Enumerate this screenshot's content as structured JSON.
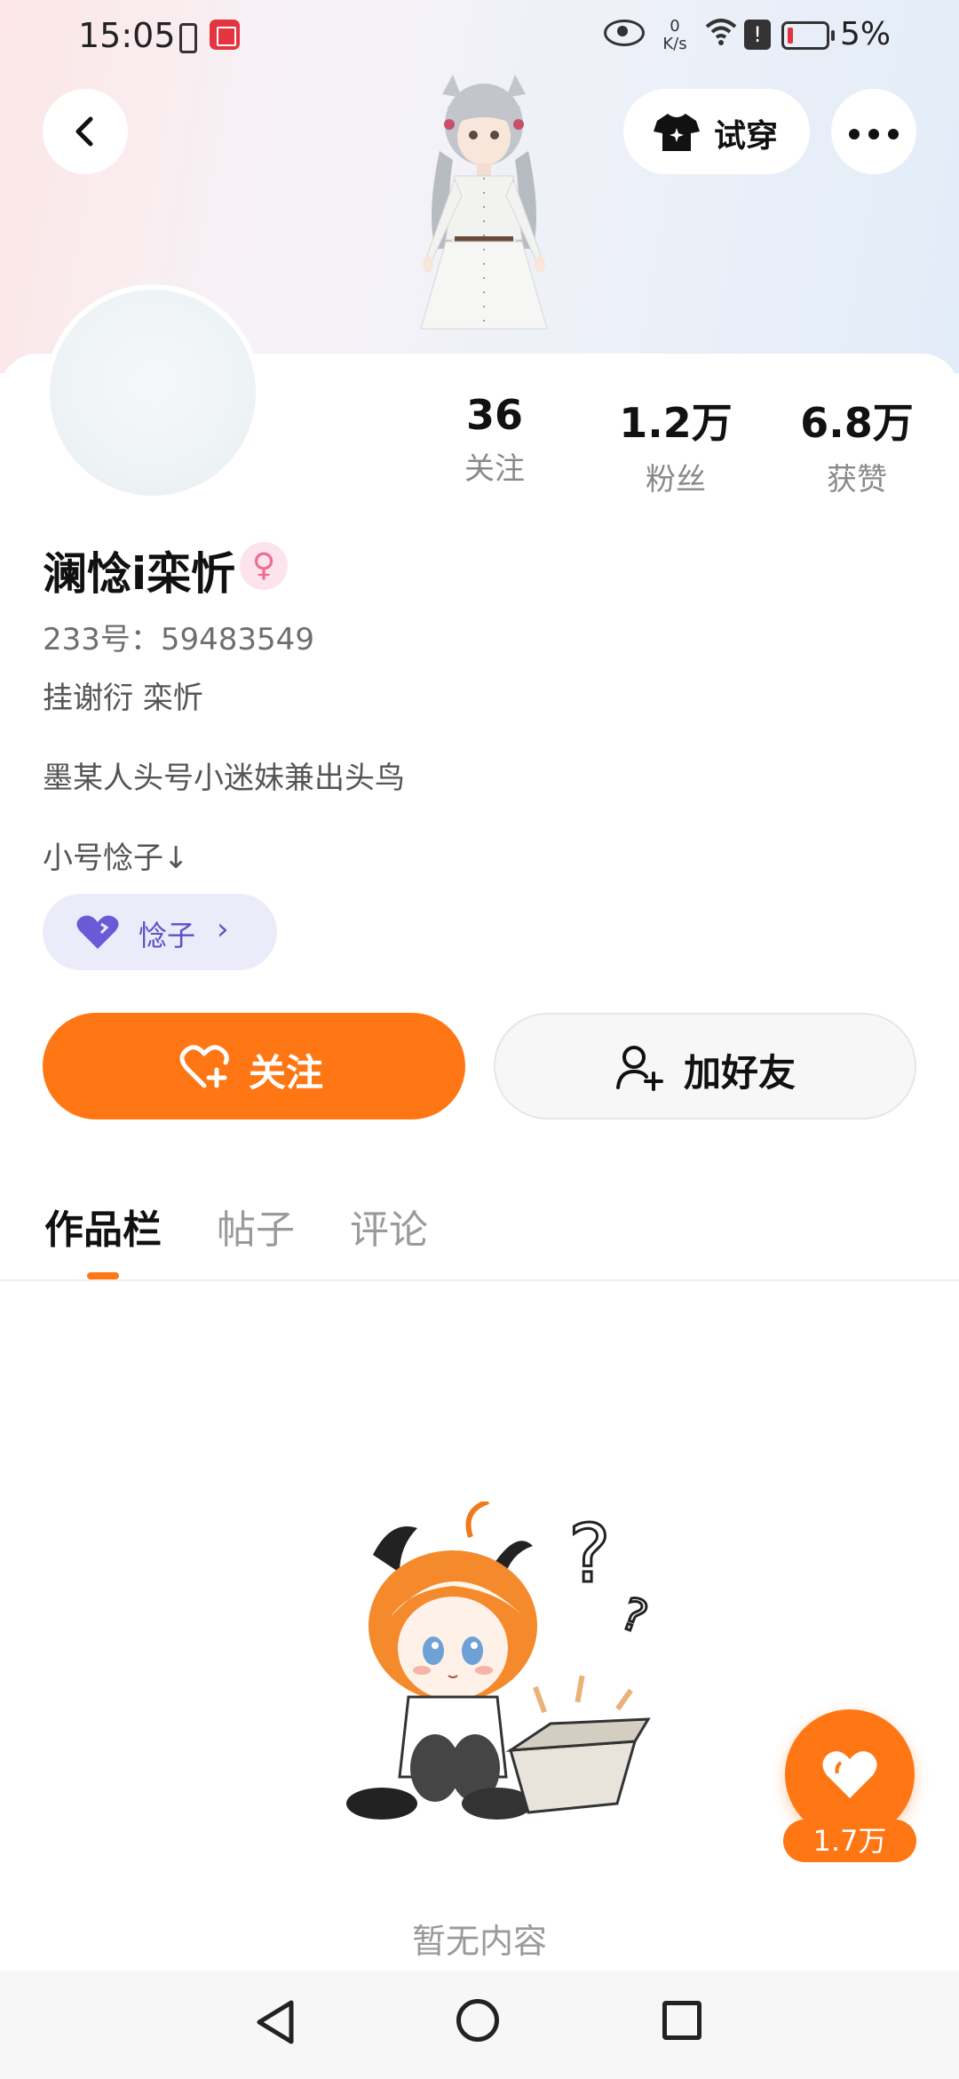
{
  "status_bar": {
    "time": "15:05",
    "net_speed_value": "0",
    "net_speed_unit": "K/s",
    "battery_percent": "5%",
    "icons": [
      "phone-icon",
      "reader-app-icon",
      "eye-icon",
      "wifi-icon",
      "alert-icon",
      "battery-icon"
    ]
  },
  "header": {
    "try_on_label": "试穿",
    "icons": [
      "back-arrow-icon",
      "tshirt-icon",
      "more-dots-icon"
    ]
  },
  "stats": [
    {
      "value": "36",
      "label": "关注"
    },
    {
      "value": "1.2万",
      "label": "粉丝"
    },
    {
      "value": "6.8万",
      "label": "获赞"
    }
  ],
  "profile": {
    "username": "澜惗i栾忻",
    "gender_symbol": "♀",
    "id_line": "233号：59483549",
    "bio_lines": [
      "挂谢衍 栾忻",
      "墨某人头号小迷妹兼出头鸟",
      "小号惗子↓"
    ]
  },
  "sub_account": {
    "name": "惗子",
    "chevron": "›"
  },
  "actions": {
    "follow_label": "关注",
    "add_friend_label": "加好友"
  },
  "tabs": [
    {
      "label": "作品栏",
      "active": true
    },
    {
      "label": "帖子",
      "active": false
    },
    {
      "label": "评论",
      "active": false
    }
  ],
  "empty_state": {
    "text": "暂无内容",
    "question_marks": "?",
    "small_question": "?"
  },
  "like_fab": {
    "count": "1.7万"
  },
  "colors": {
    "accent": "#fe7714",
    "sub_chip_bg": "#ecebfa",
    "sub_chip_text": "#5a52c8",
    "gender_pink": "#f06b91"
  }
}
